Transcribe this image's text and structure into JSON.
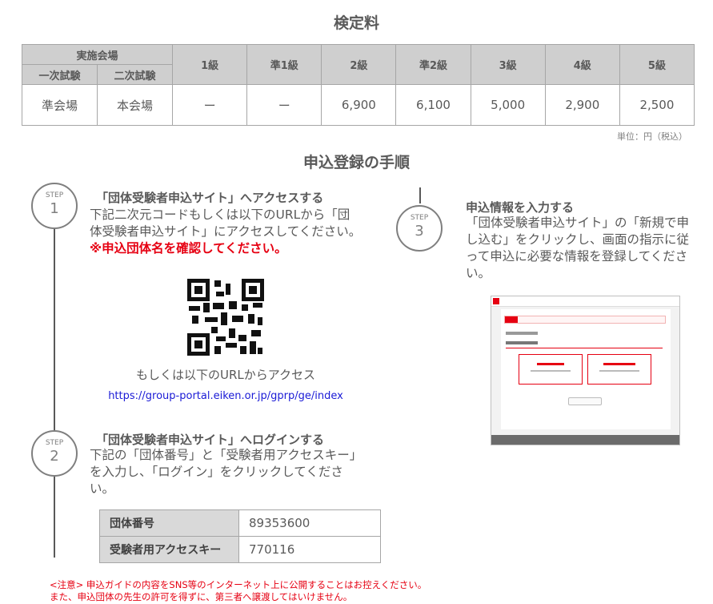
{
  "fee": {
    "title": "検定料",
    "header": {
      "venue": "実施会場",
      "first": "一次試験",
      "second": "二次試験",
      "grades": [
        "1級",
        "準1級",
        "2級",
        "準2級",
        "3級",
        "4級",
        "5級"
      ]
    },
    "row": {
      "first_venue": "準会場",
      "second_venue": "本会場",
      "prices": [
        "ー",
        "ー",
        "6,900",
        "6,100",
        "5,000",
        "2,900",
        "2,500"
      ]
    },
    "unit": "単位：円（税込）"
  },
  "procedure": {
    "title": "申込登録の手順",
    "step_label": "STEP",
    "step1": {
      "number": "1",
      "heading": "「団体受験者申込サイト」へアクセスする",
      "body": "下記二次元コードもしくは以下のURLから「団体受験者申込サイト」にアクセスしてください。",
      "warning": "※申込団体名を確認してください。",
      "url_caption": "もしくは以下のURLからアクセス",
      "url": "https://group-portal.eiken.or.jp/gprp/ge/index"
    },
    "step2": {
      "number": "2",
      "heading": "「団体受験者申込サイト」へログインする",
      "body": "下記の「団体番号」と「受験者用アクセスキー」を入力し、「ログイン」をクリックしてください。",
      "group_number_label": "団体番号",
      "group_number": "89353600",
      "access_key_label": "受験者用アクセスキー",
      "access_key": "770116"
    },
    "step3": {
      "number": "3",
      "heading": "申込情報を入力する",
      "body": "「団体受験者申込サイト」の「新規で申し込む」をクリックし、画面の指示に従って申込に必要な情報を登録してください。"
    }
  },
  "notice": {
    "line1": "<注意> 申込ガイドの内容をSNS等のインターネット上に公開することはお控えください。",
    "line2": "また、申込団体の先生の許可を得ずに、第三者へ譲渡してはいけません。"
  },
  "colors": {
    "accent": "#e60012",
    "link": "#1a1ad6",
    "text": "#595959",
    "header_bg": "#cfcfcf"
  }
}
